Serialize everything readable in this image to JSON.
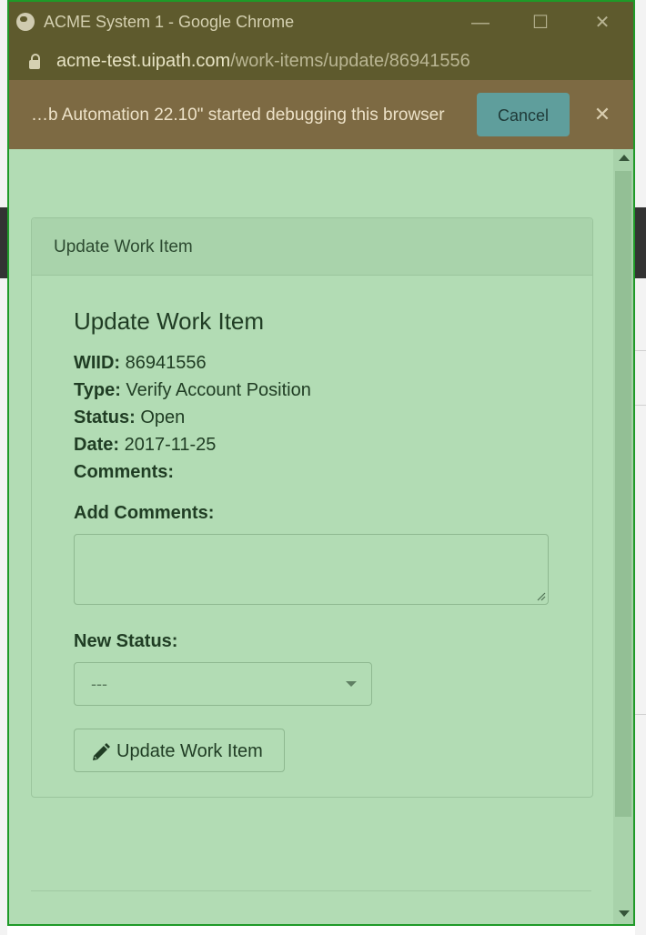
{
  "window": {
    "title": "ACME System 1 - Google Chrome",
    "url_host": "acme-test.uipath.com",
    "url_path": "/work-items/update/86941556",
    "minimize_glyph": "—",
    "maximize_glyph": "☐",
    "close_glyph": "✕"
  },
  "debug_banner": {
    "message": "…b Automation 22.10\" started debugging this browser",
    "cancel_label": "Cancel",
    "close_glyph": "✕"
  },
  "panel": {
    "heading": "Update Work Item",
    "form_title": "Update Work Item",
    "wiid_label": "WIID:",
    "wiid_value": "86941556",
    "type_label": "Type:",
    "type_value": "Verify Account Position",
    "status_label": "Status:",
    "status_value": "Open",
    "date_label": "Date:",
    "date_value": "2017-11-25",
    "comments_label": "Comments:",
    "add_comments_label": "Add Comments:",
    "add_comments_value": "",
    "new_status_label": "New Status:",
    "new_status_selected": "---",
    "update_button_label": "Update Work Item"
  },
  "icons": {
    "globe": "globe-icon",
    "lock": "lock-icon",
    "pencil": "pencil-icon",
    "chevron": "chevron-down-icon"
  },
  "colors": {
    "overlay_green": "#b2dcb4",
    "window_border": "#1f9a28",
    "debug_bar": "#7d6a43",
    "cancel_button": "#5f9e9c"
  }
}
